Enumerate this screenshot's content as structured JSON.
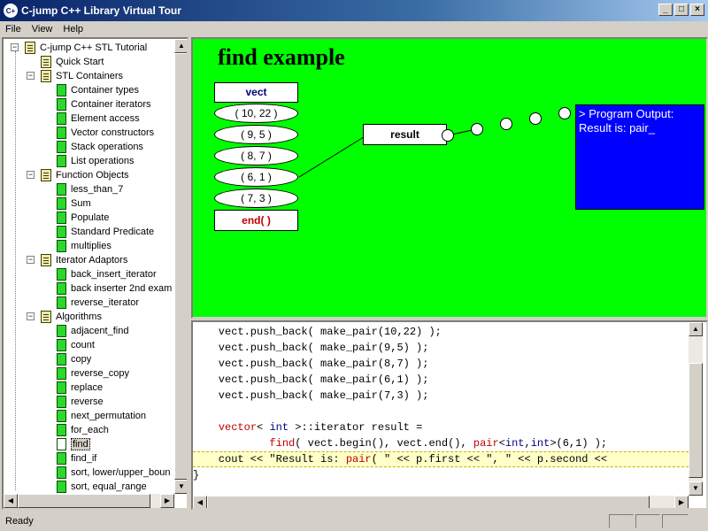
{
  "window": {
    "title": "C-jump C++ Library Virtual Tour",
    "icon": "cjump-app-icon"
  },
  "menu": [
    "File",
    "View",
    "Help"
  ],
  "tree": {
    "root": "C-jump C++ STL Tutorial",
    "items": [
      {
        "label": "Quick Start",
        "level": 1,
        "kind": "book"
      },
      {
        "label": "STL Containers",
        "level": 1,
        "kind": "book",
        "expanded": true
      },
      {
        "label": "Container types",
        "level": 2,
        "kind": "page"
      },
      {
        "label": "Container iterators",
        "level": 2,
        "kind": "page"
      },
      {
        "label": "Element access",
        "level": 2,
        "kind": "page"
      },
      {
        "label": "Vector constructors",
        "level": 2,
        "kind": "page"
      },
      {
        "label": "Stack operations",
        "level": 2,
        "kind": "page"
      },
      {
        "label": "List operations",
        "level": 2,
        "kind": "page"
      },
      {
        "label": "Function Objects",
        "level": 1,
        "kind": "book",
        "expanded": true
      },
      {
        "label": "less_than_7",
        "level": 2,
        "kind": "page"
      },
      {
        "label": "Sum",
        "level": 2,
        "kind": "page"
      },
      {
        "label": "Populate",
        "level": 2,
        "kind": "page"
      },
      {
        "label": "Standard Predicate",
        "level": 2,
        "kind": "page"
      },
      {
        "label": "multiplies",
        "level": 2,
        "kind": "page"
      },
      {
        "label": "Iterator Adaptors",
        "level": 1,
        "kind": "book",
        "expanded": true
      },
      {
        "label": "back_insert_iterator",
        "level": 2,
        "kind": "page"
      },
      {
        "label": "back inserter 2nd exam",
        "level": 2,
        "kind": "page"
      },
      {
        "label": "reverse_iterator",
        "level": 2,
        "kind": "page"
      },
      {
        "label": "Algorithms",
        "level": 1,
        "kind": "book",
        "expanded": true
      },
      {
        "label": "adjacent_find",
        "level": 2,
        "kind": "page"
      },
      {
        "label": "count",
        "level": 2,
        "kind": "page"
      },
      {
        "label": "copy",
        "level": 2,
        "kind": "page"
      },
      {
        "label": "reverse_copy",
        "level": 2,
        "kind": "page"
      },
      {
        "label": "replace",
        "level": 2,
        "kind": "page"
      },
      {
        "label": "reverse",
        "level": 2,
        "kind": "page"
      },
      {
        "label": "next_permutation",
        "level": 2,
        "kind": "page"
      },
      {
        "label": "for_each",
        "level": 2,
        "kind": "page"
      },
      {
        "label": "find",
        "level": 2,
        "kind": "page",
        "selected": true
      },
      {
        "label": "find_if",
        "level": 2,
        "kind": "page"
      },
      {
        "label": "sort, lower/upper_boun",
        "level": 2,
        "kind": "page"
      },
      {
        "label": "sort, equal_range",
        "level": 2,
        "kind": "page"
      }
    ]
  },
  "diagram": {
    "title": "find example",
    "vect_label": "vect",
    "elements": [
      "( 10, 22 )",
      "( 9, 5 )",
      "( 8, 7 )",
      "( 6, 1 )",
      "( 7, 3 )"
    ],
    "end_label": "end( )",
    "result_label": "result",
    "output_line1": "> Program Output:",
    "output_line2": "Result is: pair_",
    "colors": {
      "background": "#00ff00",
      "output": "#0000ff",
      "end": "#c00000",
      "vect": "#000080"
    }
  },
  "code": {
    "lines": [
      {
        "parts": [
          {
            "t": "    vect.push_back( make_pair(10,22) );"
          }
        ]
      },
      {
        "parts": [
          {
            "t": "    vect.push_back( make_pair(9,5) );"
          }
        ]
      },
      {
        "parts": [
          {
            "t": "    vect.push_back( make_pair(8,7) );"
          }
        ]
      },
      {
        "parts": [
          {
            "t": "    vect.push_back( make_pair(6,1) );"
          }
        ]
      },
      {
        "parts": [
          {
            "t": "    vect.push_back( make_pair(7,3) );"
          }
        ]
      },
      {
        "parts": [
          {
            "t": ""
          }
        ]
      },
      {
        "parts": [
          {
            "t": "    "
          },
          {
            "t": "vector",
            "c": "red"
          },
          {
            "t": "< "
          },
          {
            "t": "int",
            "c": "blue"
          },
          {
            "t": " >::iterator result ="
          }
        ]
      },
      {
        "parts": [
          {
            "t": "            "
          },
          {
            "t": "find",
            "c": "red"
          },
          {
            "t": "( vect.begin(), vect.end(), "
          },
          {
            "t": "pair",
            "c": "red"
          },
          {
            "t": "<"
          },
          {
            "t": "int",
            "c": "blue"
          },
          {
            "t": ","
          },
          {
            "t": "int",
            "c": "blue"
          },
          {
            "t": ">(6,1) );"
          }
        ]
      },
      {
        "parts": [
          {
            "t": "    cout << \"Result is: "
          },
          {
            "t": "pair",
            "c": "red"
          },
          {
            "t": "( \" << p.first << \", \" << p.second <<"
          }
        ],
        "highlight": true
      },
      {
        "parts": [
          {
            "t": "}"
          }
        ]
      }
    ]
  },
  "status": {
    "text": "Ready"
  }
}
